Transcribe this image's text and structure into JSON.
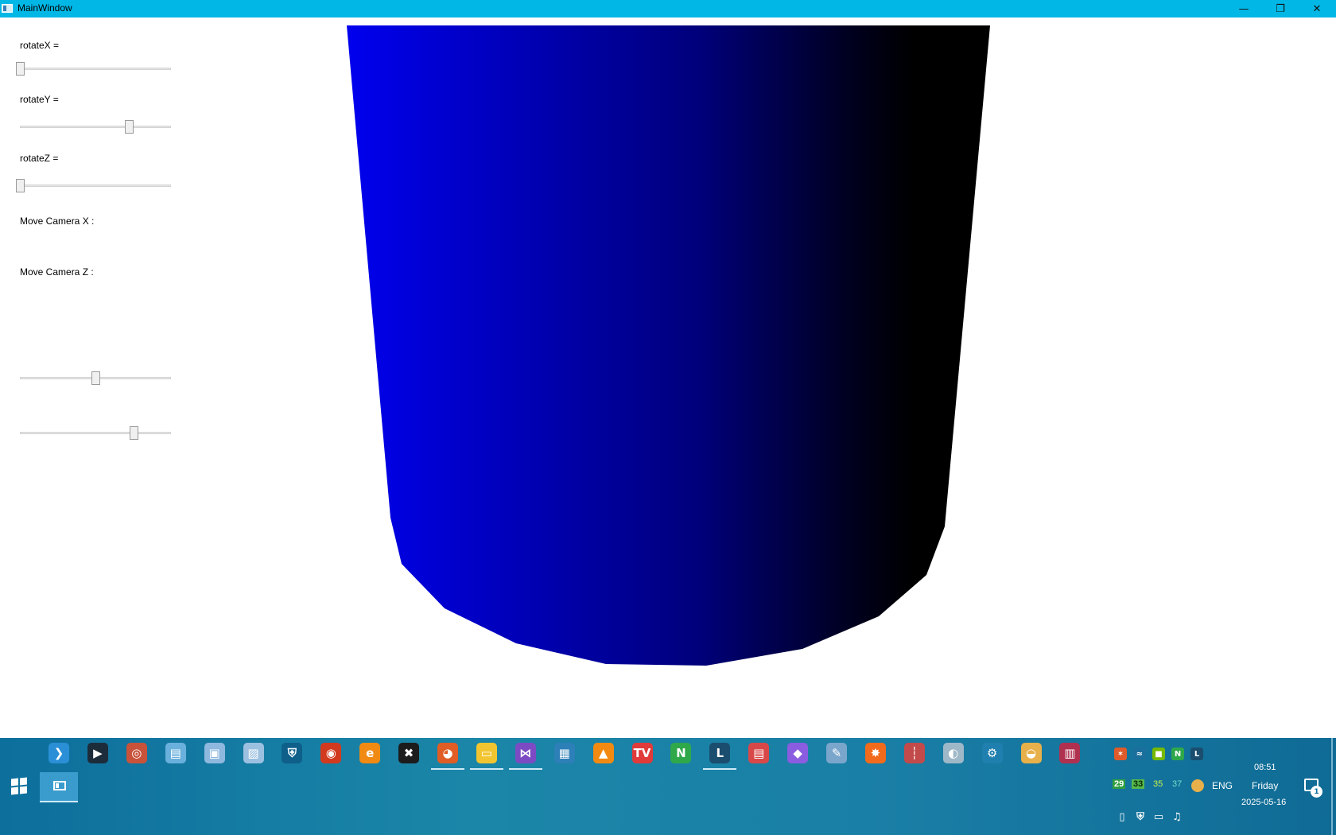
{
  "window": {
    "title": "MainWindow",
    "minimize_glyph": "—",
    "maximize_glyph": "❐",
    "close_glyph": "✕"
  },
  "controls": {
    "rotate_x": {
      "label": "rotateX =",
      "position_fraction": 0.0
    },
    "rotate_y": {
      "label": "rotateY =",
      "position_fraction": 0.72
    },
    "rotate_z": {
      "label": "rotateZ =",
      "position_fraction": 0.0
    },
    "move_camera_x": {
      "label": "Move Camera X :",
      "position_fraction": 0.5
    },
    "move_camera_z": {
      "label": "Move Camera Z :",
      "position_fraction": 0.75
    }
  },
  "scene": {
    "object": "cylinder",
    "gradient_colors": [
      "#0000ee",
      "#0000b0",
      "#00007a",
      "#000020",
      "#000000"
    ]
  },
  "taskbar": {
    "pinned": [
      {
        "name": "vscode-icon",
        "glyph": "❯",
        "color": "#2a8fd6",
        "running": false
      },
      {
        "name": "media-player-icon",
        "glyph": "▶",
        "color": "#1d2c3a",
        "running": false
      },
      {
        "name": "globe-browser-icon",
        "glyph": "◎",
        "color": "#c8523a",
        "running": false
      },
      {
        "name": "notes-icon",
        "glyph": "▤",
        "color": "#6ab0dc",
        "running": false
      },
      {
        "name": "picture-viewer-icon",
        "glyph": "▣",
        "color": "#8fb8df",
        "running": false
      },
      {
        "name": "image-viewer-icon",
        "glyph": "▨",
        "color": "#9cc0e0",
        "running": false
      },
      {
        "name": "security-shield-icon",
        "glyph": "⛨",
        "color": "#0e5f8a",
        "running": false
      },
      {
        "name": "record-icon",
        "glyph": "◉",
        "color": "#d23a1f",
        "running": false
      },
      {
        "name": "edge-legacy-icon",
        "glyph": "e",
        "color": "#f08a12",
        "running": false
      },
      {
        "name": "xmind-icon",
        "glyph": "✖",
        "color": "#1c1c1c",
        "running": false
      },
      {
        "name": "firefox-icon",
        "glyph": "◕",
        "color": "#e05d25",
        "running": true
      },
      {
        "name": "file-explorer-icon",
        "glyph": "▭",
        "color": "#f2c530",
        "running": true
      },
      {
        "name": "visual-studio-icon",
        "glyph": "⋈",
        "color": "#7c4bc4",
        "running": true
      },
      {
        "name": "calculator-icon",
        "glyph": "▦",
        "color": "#2d7fb8",
        "running": false
      },
      {
        "name": "vlc-icon",
        "glyph": "▲",
        "color": "#f28a12",
        "running": false
      },
      {
        "name": "tv-app-icon",
        "glyph": "TV",
        "color": "#e03a3a",
        "running": false
      },
      {
        "name": "n-app-icon",
        "glyph": "N",
        "color": "#2fa84a",
        "running": false
      },
      {
        "name": "l-app-icon",
        "glyph": "L",
        "color": "#1a4d6e",
        "running": true
      },
      {
        "name": "flag-app-icon",
        "glyph": "▤",
        "color": "#d94848",
        "running": false
      },
      {
        "name": "maps-pin-icon",
        "glyph": "◆",
        "color": "#8a5ce0",
        "running": false
      },
      {
        "name": "paint-icon",
        "glyph": "✎",
        "color": "#7aa6cc",
        "running": false
      },
      {
        "name": "photo-editor-icon",
        "glyph": "✸",
        "color": "#f26a1b",
        "running": false
      },
      {
        "name": "thermometer-app-icon",
        "glyph": "┆",
        "color": "#c24a4a",
        "running": false
      },
      {
        "name": "disc-app-icon",
        "glyph": "◐",
        "color": "#9fb8c8",
        "running": false
      },
      {
        "name": "settings-gear-icon",
        "glyph": "⚙",
        "color": "#1f7fae",
        "running": false
      },
      {
        "name": "weather-icon",
        "glyph": "◒",
        "color": "#e8b04a",
        "running": false
      },
      {
        "name": "archive-icon",
        "glyph": "▥",
        "color": "#b03050",
        "running": false
      }
    ],
    "tray_top": [
      {
        "name": "tray-app1-icon",
        "glyph": "✶",
        "color": "#e05a2a"
      },
      {
        "name": "tray-app2-icon",
        "glyph": "≈",
        "color": "#1b6f9c"
      },
      {
        "name": "tray-nvidia-icon",
        "glyph": "■",
        "color": "#76b900"
      },
      {
        "name": "tray-n-icon",
        "glyph": "N",
        "color": "#2fa84a"
      },
      {
        "name": "tray-l-icon",
        "glyph": "L",
        "color": "#1a4d6e"
      }
    ],
    "temps": [
      "29",
      "33",
      "35",
      "37"
    ],
    "language": "ENG",
    "tray_bottom": [
      {
        "name": "usb-icon",
        "glyph": "▯"
      },
      {
        "name": "defender-icon",
        "glyph": "⛨"
      },
      {
        "name": "network-icon",
        "glyph": "▭"
      },
      {
        "name": "volume-icon",
        "glyph": "♫"
      }
    ],
    "clock": {
      "time": "08:51",
      "day": "Friday",
      "date": "2025-05-16"
    },
    "notifications": {
      "count": "1"
    }
  }
}
